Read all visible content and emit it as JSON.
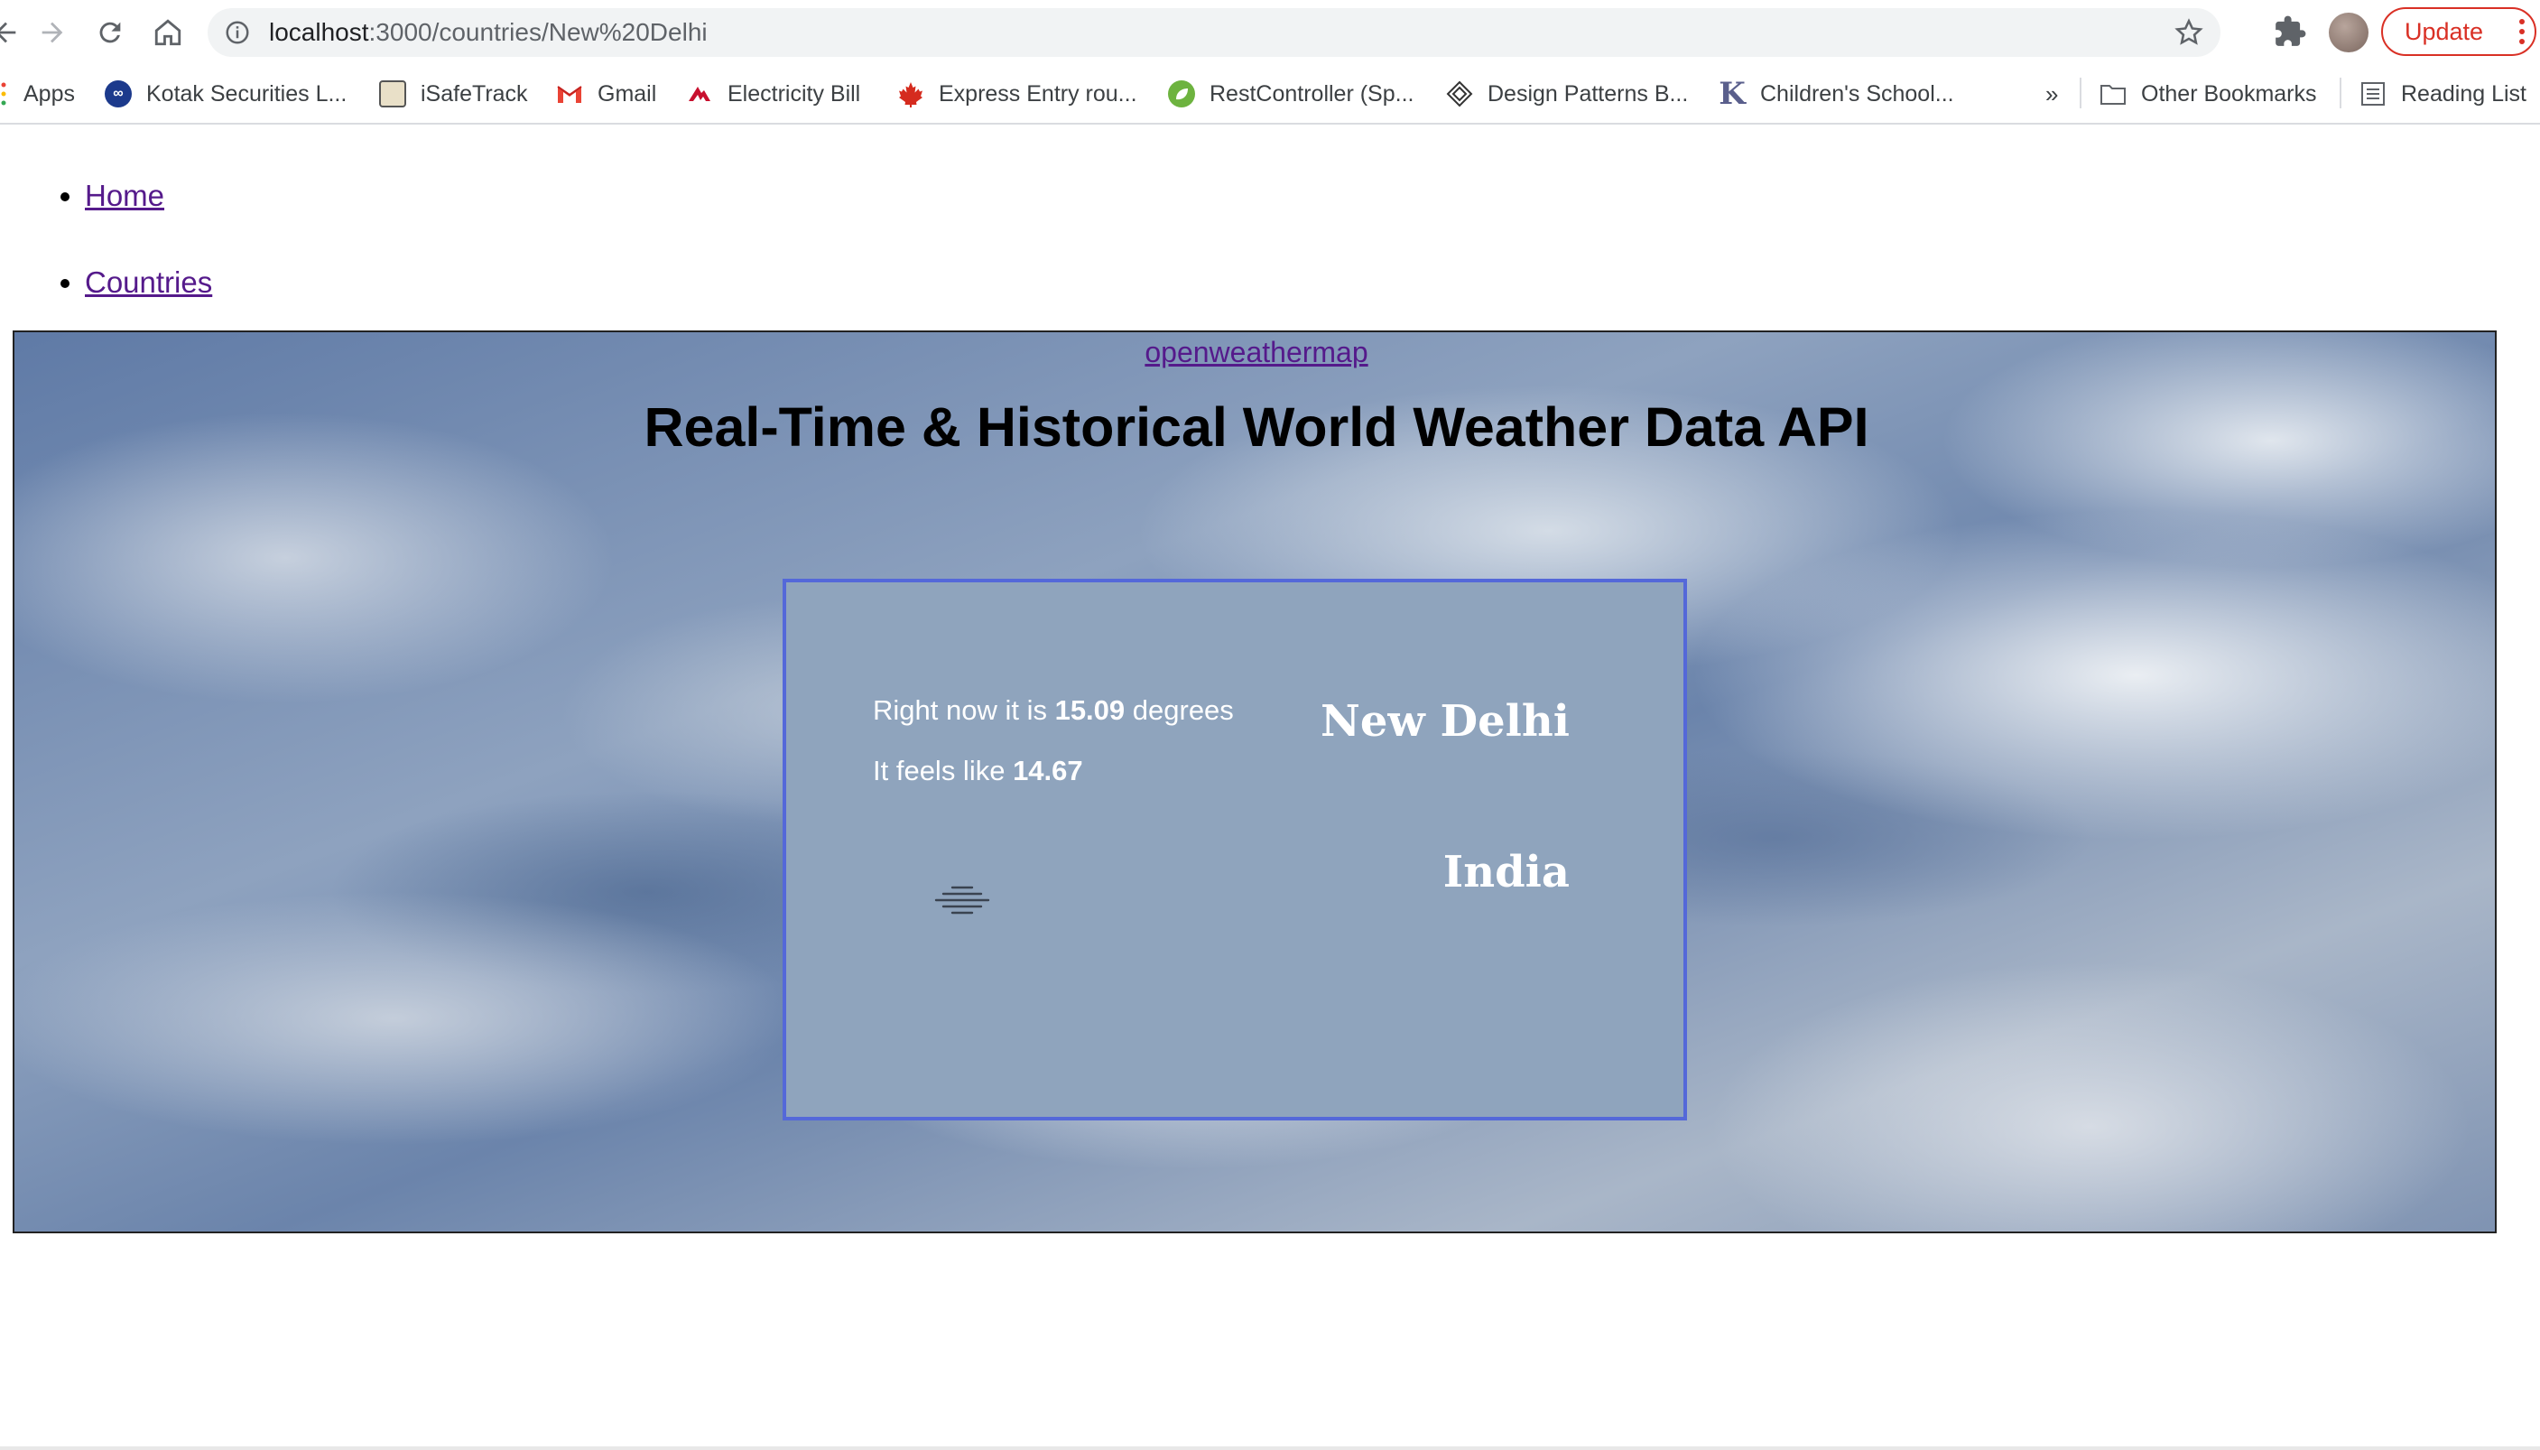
{
  "browser": {
    "url_host": "localhost",
    "url_path": ":3000/countries/New%20Delhi",
    "update_label": "Update",
    "bookmarks": [
      {
        "label": "Apps",
        "icon": "apps-grid-icon"
      },
      {
        "label": "Kotak Securities L...",
        "icon": "kotak-icon"
      },
      {
        "label": "iSafeTrack",
        "icon": "isafetrack-icon"
      },
      {
        "label": "Gmail",
        "icon": "gmail-icon"
      },
      {
        "label": "Electricity Bill",
        "icon": "electricity-icon"
      },
      {
        "label": "Express Entry rou...",
        "icon": "maple-leaf-icon"
      },
      {
        "label": "RestController (Sp...",
        "icon": "spring-leaf-icon"
      },
      {
        "label": "Design Patterns B...",
        "icon": "design-patterns-icon"
      },
      {
        "label": "Children's School...",
        "icon": "k-letter-icon"
      }
    ],
    "overflow_label": "»",
    "other_bookmarks": "Other Bookmarks",
    "reading_list": "Reading List"
  },
  "nav": {
    "home": "Home",
    "countries": "Countries"
  },
  "hero": {
    "link": "openweathermap",
    "title": "Real-Time & Historical World Weather Data API"
  },
  "weather": {
    "temp_prefix": "Right now it is ",
    "temp_value": "15.09",
    "temp_suffix": " degrees",
    "feels_prefix": "It feels like ",
    "feels_value": "14.67",
    "city": "New Delhi",
    "country": "India",
    "condition_icon": "mist-icon"
  },
  "colors": {
    "card_bg": "#8fa4bd",
    "card_border": "#5468d9",
    "link_visited": "#551a8b",
    "update_red": "#d93025"
  }
}
